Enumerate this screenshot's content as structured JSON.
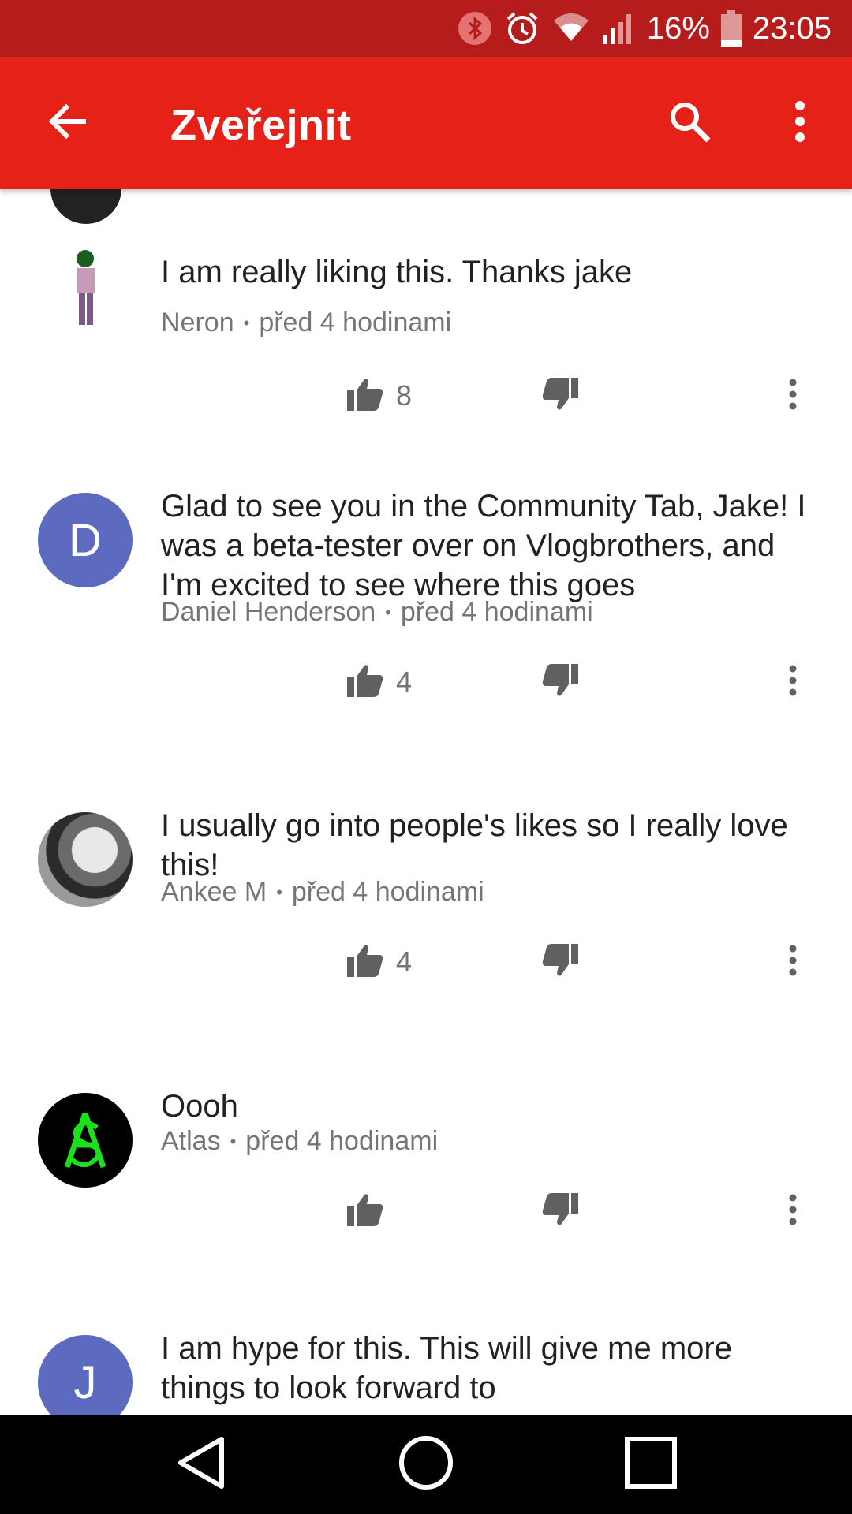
{
  "status_bar": {
    "battery": "16%",
    "time": "23:05",
    "icons": [
      "bluetooth-icon",
      "alarm-icon",
      "wifi-icon",
      "signal-icon",
      "battery-icon"
    ]
  },
  "app_bar": {
    "title": "Zveřejnit",
    "icons": [
      "back-arrow-icon",
      "search-icon",
      "more-vert-icon"
    ]
  },
  "comments": [
    {
      "text": "I am really liking this. Thanks jake",
      "author": "Neron",
      "time": "před 4 hodinami",
      "likes": "8",
      "avatar": "figure"
    },
    {
      "text": "Glad to see you in the Community Tab, Jake! I was a beta-tester over on Vlogbrothers, and I'm excited to see where this goes",
      "author": "Daniel Henderson",
      "time": "před 4 hodinami",
      "likes": "4",
      "avatar_letter": "D"
    },
    {
      "text": "I usually go into people's likes so I really love this!",
      "author": "Ankee M",
      "time": "před 4 hodinami",
      "likes": "4",
      "avatar": "photo"
    },
    {
      "text": "Oooh",
      "author": "Atlas",
      "time": "před 4 hodinami",
      "likes": "",
      "avatar": "atlas-logo"
    },
    {
      "text": "I am hype for this. This will give me more things to look forward to",
      "avatar_letter": "J"
    }
  ],
  "colors": {
    "status_bar": "#b71c1c",
    "app_bar": "#e62117",
    "avatar_letter_bg": "#5c6bc0",
    "meta_text": "#757575"
  }
}
